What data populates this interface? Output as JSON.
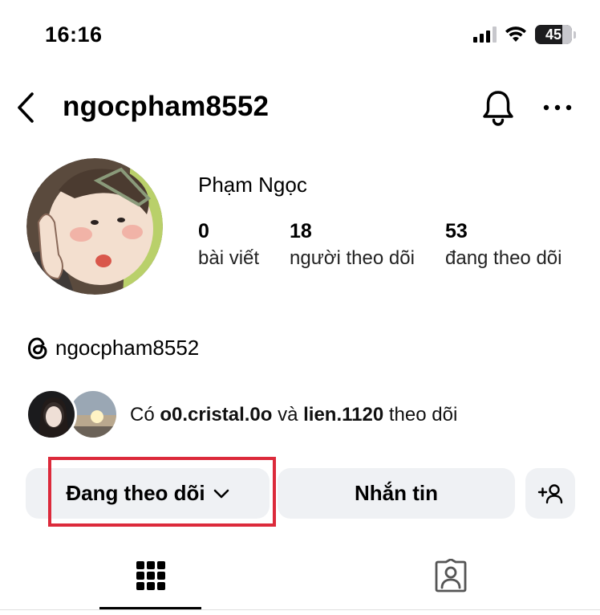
{
  "status_bar": {
    "time": "16:16",
    "battery": "45"
  },
  "header": {
    "username": "ngocpham8552"
  },
  "profile": {
    "display_name": "Phạm Ngọc",
    "stats": [
      {
        "value": "0",
        "label": "bài viết"
      },
      {
        "value": "18",
        "label": "người theo dõi"
      },
      {
        "value": "53",
        "label": "đang theo dõi"
      }
    ],
    "threads_handle": "ngocpham8552"
  },
  "mutuals": {
    "prefix": "Có",
    "user1": "o0.cristal.0o",
    "conjunction": "và",
    "user2": "lien.1120",
    "suffix": "theo dõi"
  },
  "actions": {
    "following_label": "Đang theo dõi",
    "message_label": "Nhắn tin"
  },
  "tabs": [
    {
      "name": "posts-grid",
      "icon": "grid-icon",
      "active": true
    },
    {
      "name": "tagged",
      "icon": "person-tag-icon",
      "active": false
    }
  ],
  "colors": {
    "highlight": "#dc2a3b",
    "button_bg": "#eff1f4"
  }
}
